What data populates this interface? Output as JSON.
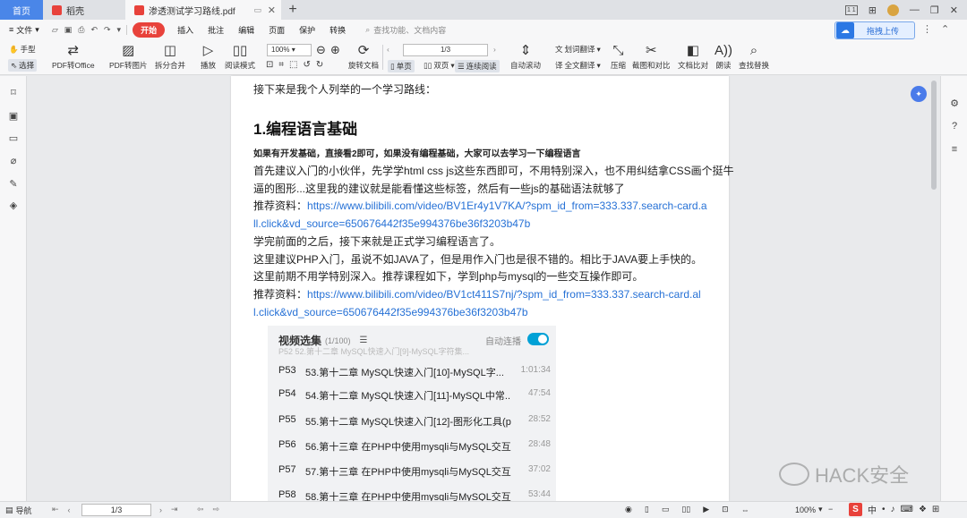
{
  "tabs": {
    "home": "首页",
    "daoke": "稻壳",
    "active": "渗透测试学习路线.pdf",
    "new_tab": "+"
  },
  "menu": {
    "file": "文件",
    "start": "开始",
    "items": [
      "插入",
      "批注",
      "编辑",
      "页面",
      "保护",
      "转换"
    ],
    "search_placeholder": "查找功能、文档内容",
    "upload": "拖拽上传"
  },
  "toolbar": {
    "hand": "手型",
    "select": "选择",
    "pdf_to_office": "PDF转Office",
    "pdf_to_image": "PDF转图片",
    "split_merge": "拆分合并",
    "play": "播放",
    "read_mode": "阅读模式",
    "zoom": "100%",
    "rotate": "旋转文档",
    "single_page": "单页",
    "double_page": "双页",
    "continuous": "连续阅读",
    "page": "1/3",
    "auto_scroll": "自动滚动",
    "translate_word": "划词翻译",
    "translate_full": "全文翻译",
    "compress": "压缩",
    "screenshot_compare": "截图和对比",
    "doc_compare": "文档比对",
    "read_aloud": "朗读",
    "find_replace": "查找替换"
  },
  "document": {
    "intro": "接下来是我个人列举的一个学习路线：",
    "heading": "1.编程语言基础",
    "bold_line": "如果有开发基础，直接看2即可，如果没有编程基础，大家可以去学习一下编程语言",
    "line1": "首先建议入门的小伙伴，先学学html css js这些东西即可，不用特别深入，也不用纠结拿CSS画个挺牛",
    "line2": "逼的图形...这里我的建议就是能看懂这些标签，然后有一些js的基础语法就够了",
    "rec_label": "推荐资料：",
    "link1a": "https://www.bilibili.com/video/BV1Er4y1V7KA/?spm_id_from=333.337.search-card.a",
    "link1b": "ll.click&vd_source=650676442f35e994376be36f3203b47b",
    "line3": "学完前面的之后，接下来就是正式学习编程语言了。",
    "line4": "这里建议PHP入门，虽说不如JAVA了，但是用作入门也是很不错的。相比于JAVA要上手快的。",
    "line5": "这里前期不用学特别深入。推荐课程如下，学到php与mysql的一些交互操作即可。",
    "rec_label2": "推荐资料：",
    "link2a": "https://www.bilibili.com/video/BV1ct411S7nj/?spm_id_from=333.337.search-card.al",
    "link2b": "l.click&vd_source=650676442f35e994376be36f3203b47b"
  },
  "video_panel": {
    "title": "视频选集",
    "count": "(1/100)",
    "autoplay": "自动连播",
    "partial_row": "P52 52.第十二章 MySQL快速入门[9]-MySQL字符集...",
    "rows": [
      {
        "p": "P53",
        "title": "53.第十二章 MySQL快速入门[10]-MySQL字...",
        "dur": "1:01:34"
      },
      {
        "p": "P54",
        "title": "54.第十二章 MySQL快速入门[11]-MySQL中常...",
        "dur": "47:54"
      },
      {
        "p": "P55",
        "title": "55.第十二章 MySQL快速入门[12]-图形化工具(p...",
        "dur": "28:52"
      },
      {
        "p": "P56",
        "title": "56.第十三章 在PHP中使用mysqli与MySQL交互[...",
        "dur": "28:48"
      },
      {
        "p": "P57",
        "title": "57.第十三章 在PHP中使用mysqli与MySQL交互[...",
        "dur": "37:02"
      },
      {
        "p": "P58",
        "title": "58.第十三章 在PHP中使用mysqli与MySQL交互[...",
        "dur": "53:44"
      }
    ]
  },
  "watermark": "HACK安全",
  "statusbar": {
    "nav": "导航",
    "page": "1/3",
    "zoom": "100%",
    "ime_lang": "中"
  },
  "colors": {
    "accent_red": "#e8423b",
    "accent_blue": "#4a86e8",
    "link": "#2671d6",
    "toggle": "#00a1d6"
  }
}
